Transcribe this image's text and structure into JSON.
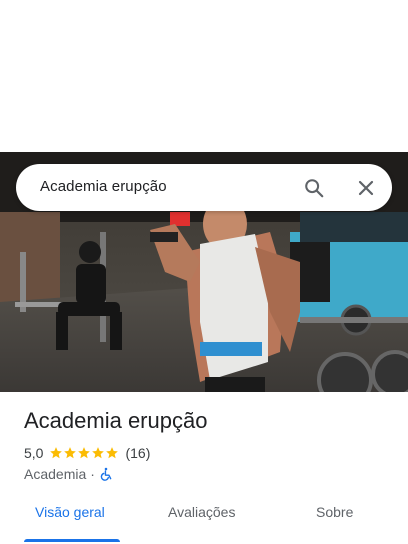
{
  "search": {
    "query": "Academia erupção"
  },
  "place": {
    "name": "Academia erupção",
    "rating": "5,0",
    "stars": 5,
    "review_count": "(16)",
    "category": "Academia",
    "separator": "·"
  },
  "tabs": [
    {
      "label": "Visão geral",
      "active": true
    },
    {
      "label": "Avaliações",
      "active": false
    },
    {
      "label": "Sobre",
      "active": false
    }
  ],
  "colors": {
    "accent": "#1a73e8",
    "star": "#fbbc04",
    "text": "#202124",
    "muted": "#5f6368"
  },
  "icons": {
    "search": "search-icon",
    "close": "close-icon",
    "star": "star-icon",
    "accessibility": "wheelchair-icon"
  }
}
